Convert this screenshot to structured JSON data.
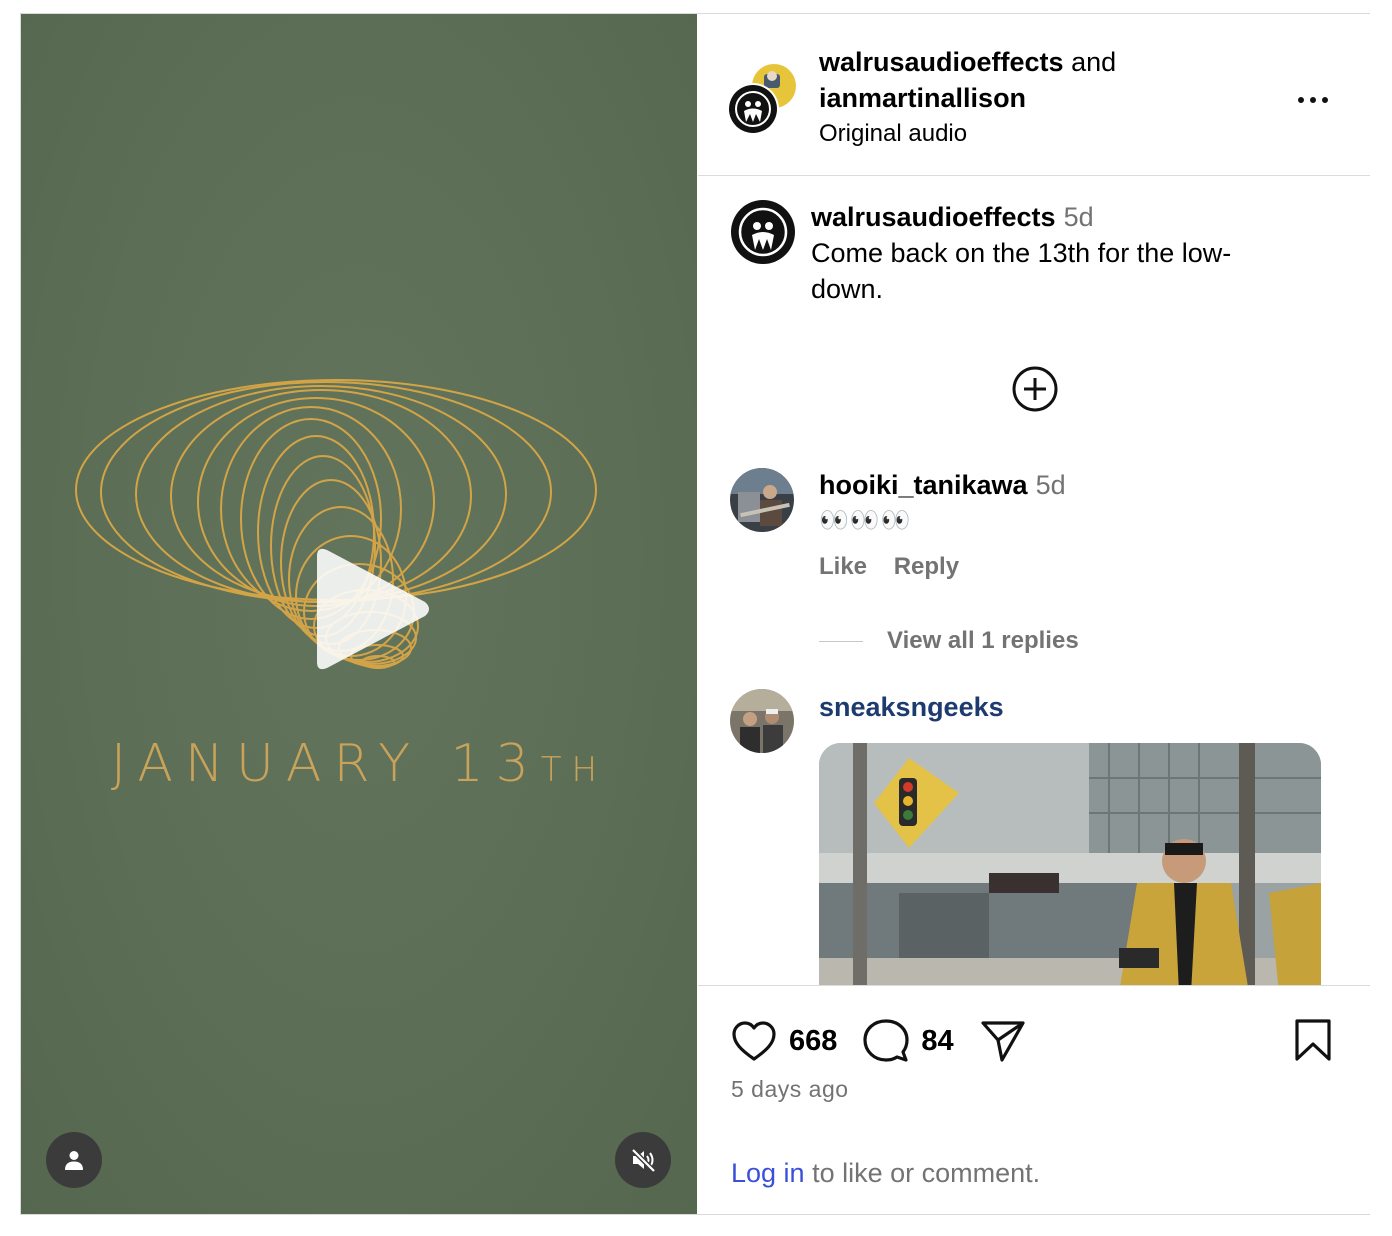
{
  "video": {
    "overlay_date": "JANUARY 13",
    "overlay_suffix": "TH",
    "play_icon": "play-icon",
    "user_icon": "person-icon",
    "mute_icon": "muted-speaker-icon",
    "background_color": "#5f7059",
    "accent_color": "#c9a35a"
  },
  "header": {
    "user1": "walrusaudioeffects",
    "joiner": " and",
    "user2": "ianmartinallison",
    "audio": "Original audio",
    "more_icon": "more-horizontal-icon"
  },
  "caption": {
    "user": "walrusaudioeffects",
    "time": "5d",
    "text": "Come back on the 13th for the low-down."
  },
  "load_more_icon": "plus-circle-icon",
  "comments": [
    {
      "user": "hooiki_tanikawa",
      "time": "5d",
      "text": "👀👀👀",
      "like_label": "Like",
      "reply_label": "Reply",
      "view_replies": "View all 1 replies"
    },
    {
      "user": "sneaksngeeks",
      "attachment": "gif"
    }
  ],
  "footer": {
    "likes": "668",
    "comments": "84",
    "ago": "5 days ago",
    "login_link": "Log in",
    "login_rest": " to like or comment.",
    "link_color": "#3a50d9"
  }
}
